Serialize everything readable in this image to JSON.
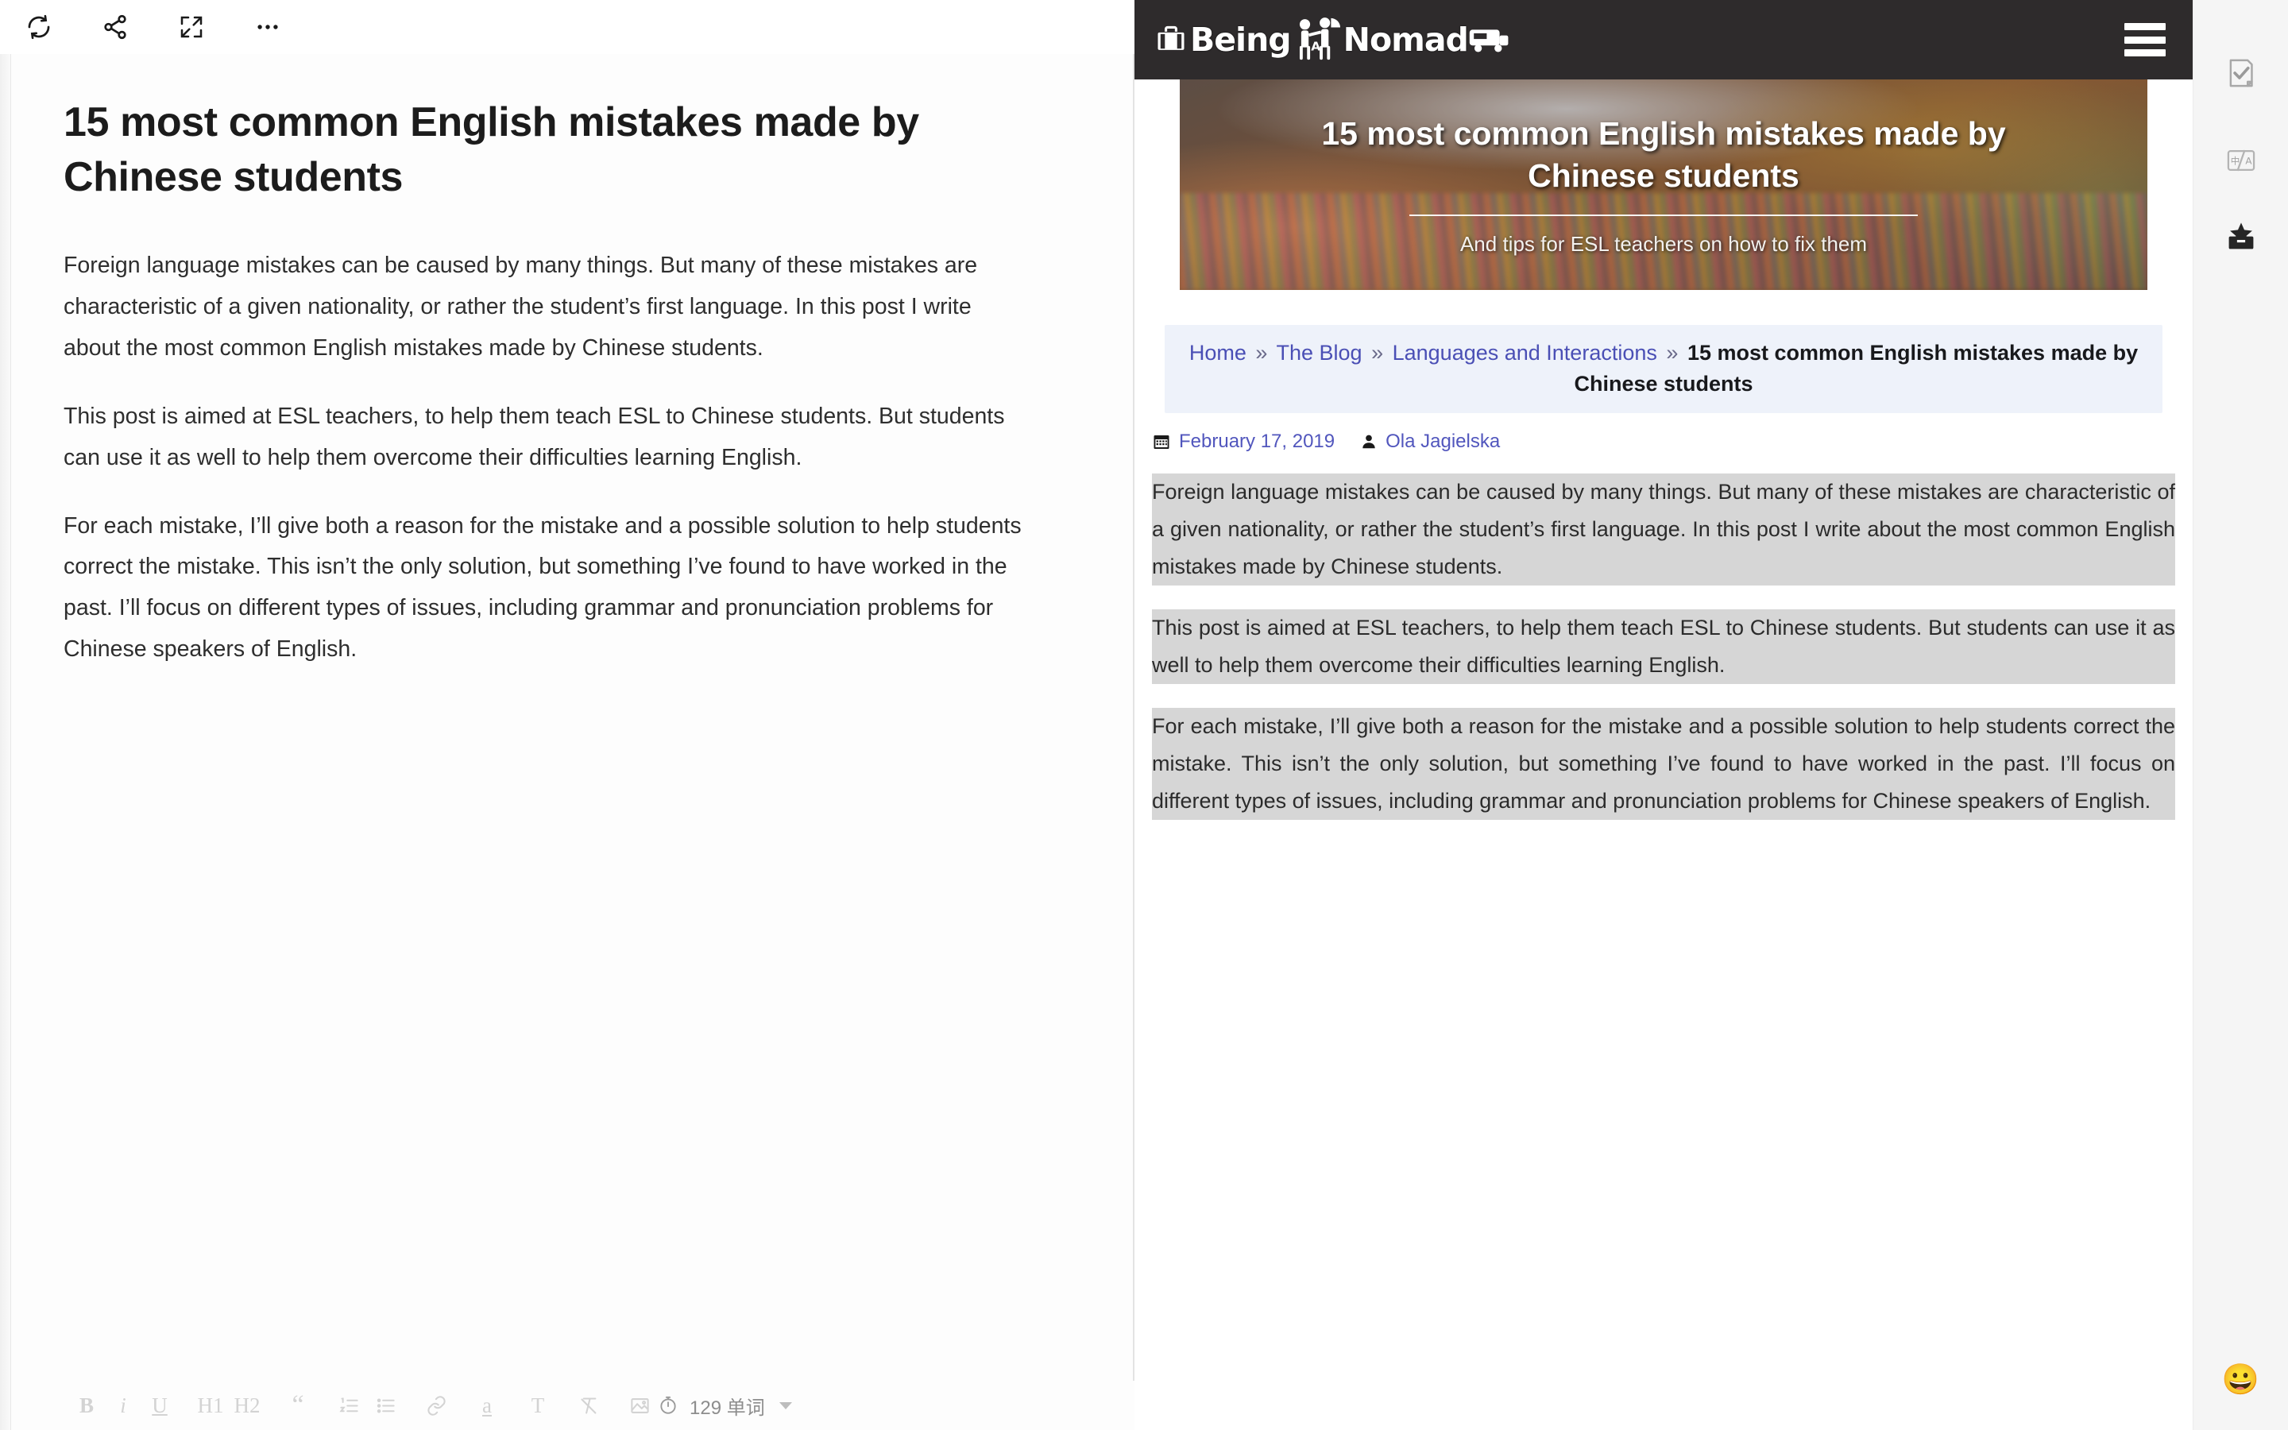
{
  "editor": {
    "toolbar_top": [
      {
        "name": "sync-icon",
        "label": "Sync"
      },
      {
        "name": "share-icon",
        "label": "Share"
      },
      {
        "name": "fullscreen-icon",
        "label": "Fullscreen"
      },
      {
        "name": "more-icon",
        "label": "More"
      }
    ],
    "title": "15 most common English mistakes made by Chinese students",
    "paragraphs": [
      "Foreign language mistakes can be caused by many things. But many of these mistakes are characteristic of a given nationality, or rather the student’s first language. In this post I write about the most common English mistakes made by Chinese students.",
      "This post is aimed at ESL teachers, to help them teach ESL to Chinese students. But students can use it as well to help them overcome their difficulties learning English.",
      "For each mistake, I’ll give both a reason for the mistake and a possible solution to help students correct the mistake. This isn’t the only solution, but something I’ve found to have worked in the past. I’ll focus on different types of issues, including grammar and pronunciation problems for Chinese speakers of English."
    ],
    "format_toolbar": [
      {
        "name": "bold-button",
        "label": "B"
      },
      {
        "name": "italic-button",
        "label": "i"
      },
      {
        "name": "underline-button",
        "label": "U"
      },
      {
        "name": "heading-1-button",
        "label": "H1"
      },
      {
        "name": "heading-2-button",
        "label": "H2"
      },
      {
        "name": "blockquote-button",
        "label": "“"
      },
      {
        "name": "ordered-list-button",
        "label": "Ordered list"
      },
      {
        "name": "unordered-list-button",
        "label": "Bullet list"
      },
      {
        "name": "link-button",
        "label": "Link"
      },
      {
        "name": "highlight-button",
        "label": "a"
      },
      {
        "name": "text-style-button",
        "label": "T"
      },
      {
        "name": "clear-format-button",
        "label": "Clear format"
      },
      {
        "name": "insert-image-button",
        "label": "Image"
      }
    ],
    "word_count": "129 单词",
    "word_count_icon": "stopwatch-icon"
  },
  "preview": {
    "site_logo": "Being A Nomad",
    "menu_icon": "hamburger-menu-icon",
    "hero": {
      "title": "15 most common English mistakes made by Chinese students",
      "subtitle": "And tips for ESL teachers on how to fix them"
    },
    "breadcrumb": {
      "items": [
        "Home",
        "The Blog",
        "Languages and Interactions"
      ],
      "separator": "»",
      "current": "15 most common English mistakes made by Chinese students"
    },
    "meta": {
      "date_icon": "calendar-icon",
      "date": "February 17, 2019",
      "author_icon": "user-icon",
      "author": "Ola Jagielska"
    },
    "paragraphs": [
      "Foreign language mistakes can be caused by many things. But many of these mistakes are characteristic of a given nationality, or rather the student’s first language. In this post I write about the most common English mistakes made by Chinese students.",
      "This post is aimed at ESL teachers, to help them teach ESL to Chinese students. But students can use it as well to help them overcome their difficulties learning English.",
      "For each mistake, I’ll give both a reason for the mistake and a possible solution to help students correct the mistake. This isn’t the only solution, but something I’ve found to have worked in the past. I’ll focus on different types of issues, including grammar and pronunciation problems for Chinese speakers of English."
    ]
  },
  "rail": {
    "buttons": [
      {
        "name": "proofread-icon",
        "label": "Proofread"
      },
      {
        "name": "translate-icon",
        "label": "Translate"
      },
      {
        "name": "toolbox-icon",
        "label": "Toolbox"
      }
    ],
    "emoji": "😀"
  },
  "colors": {
    "link": "#4a4fb5",
    "header_bg": "#2e2b2c",
    "crumb_bg": "#eef2fa",
    "selection": "#d6d6d6",
    "rail_bg": "#f5f5f5"
  }
}
